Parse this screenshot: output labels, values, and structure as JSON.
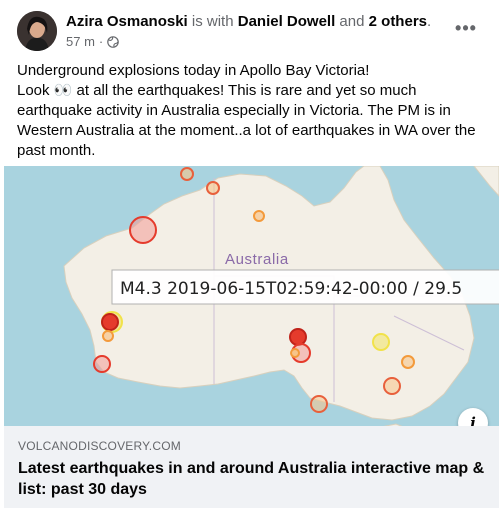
{
  "post": {
    "author": "Azira Osmanoski",
    "with_text": " is with ",
    "tagged_person": "Daniel Dowell",
    "and_text": " and ",
    "others": "2 others",
    "period": ".",
    "timestamp": "57 m",
    "separator": "·",
    "privacy_icon": "globe-icon",
    "more_icon": "more-options-icon",
    "more_label": "•••",
    "text_lines": [
      "Underground explosions today in Apollo Bay Victoria!",
      "Look 👀 at all the earthquakes! This is rare and yet so much earthquake activity in Australia especially in Victoria. The PM is in Western Australia at the moment..a lot of earthquakes in WA over the past month."
    ]
  },
  "map": {
    "country_label": "Australia",
    "tooltip": "M4.3 2019-06-15T02:59:42-00:00 / 29.5",
    "info_icon": "info-icon",
    "info_label": "i",
    "colors": {
      "ocean": "#a9d3df",
      "land": "#f3efe6",
      "quake_red": "#e53b2c",
      "quake_orange": "#f39a3b",
      "quake_yellow": "#f1e24a"
    }
  },
  "link_preview": {
    "domain": "VOLCANODISCOVERY.COM",
    "title": "Latest earthquakes in and around Australia interactive map & list: past 30 days"
  }
}
